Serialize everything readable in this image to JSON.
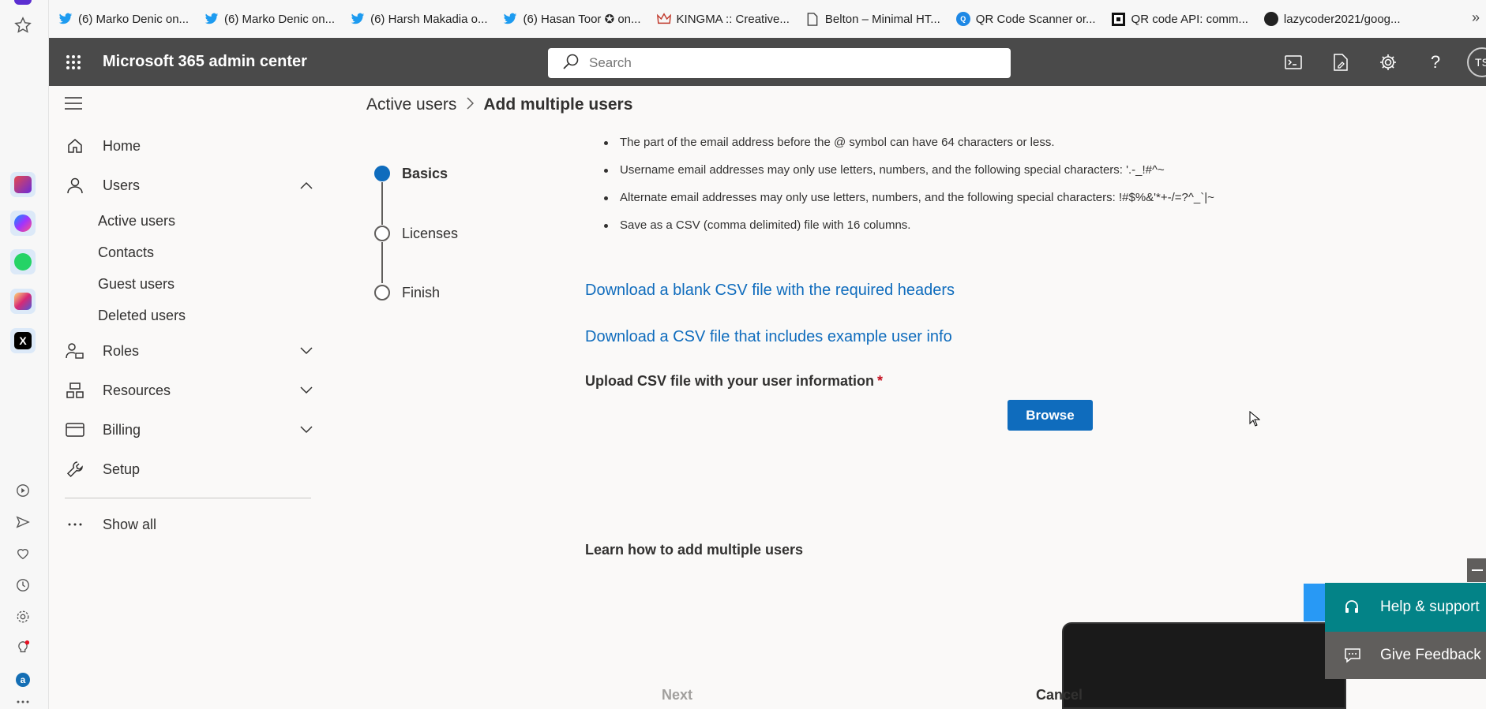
{
  "browser": {
    "bookmarks": [
      {
        "label": "(6) Marko Denic on...",
        "icon": "twitter-icon"
      },
      {
        "label": "(6) Marko Denic on...",
        "icon": "twitter-icon"
      },
      {
        "label": "(6) Harsh Makadia o...",
        "icon": "twitter-icon"
      },
      {
        "label": "(6) Hasan Toor ✪ on...",
        "icon": "twitter-icon"
      },
      {
        "label": "KINGMA :: Creative...",
        "icon": "crown-icon"
      },
      {
        "label": "Belton – Minimal HT...",
        "icon": "document-icon"
      },
      {
        "label": "QR Code Scanner or...",
        "icon": "qr-icon"
      },
      {
        "label": "QR code API: comm...",
        "icon": "qr-api-icon"
      },
      {
        "label": "lazycoder2021/goog...",
        "icon": "github-icon"
      }
    ]
  },
  "header": {
    "app_title": "Microsoft 365 admin center",
    "search_placeholder": "Search",
    "avatar_initials": "TS"
  },
  "nav": {
    "home": "Home",
    "users": "Users",
    "users_sub": [
      "Active users",
      "Contacts",
      "Guest users",
      "Deleted users"
    ],
    "roles": "Roles",
    "resources": "Resources",
    "billing": "Billing",
    "setup": "Setup",
    "show_all": "Show all"
  },
  "breadcrumb": {
    "root": "Active users",
    "current": "Add multiple users"
  },
  "steps": [
    "Basics",
    "Licenses",
    "Finish"
  ],
  "rules": [
    "The part of the email address before the @ symbol can have 64 characters or less.",
    "Username email addresses may only use letters, numbers, and the following special characters: '.-_!#^~",
    "Alternate email addresses may only use letters, numbers, and the following special characters: !#$%&'*+-/=?^_`|~",
    "Save as a CSV (comma delimited) file with 16 columns."
  ],
  "links": {
    "blank_csv": "Download a blank CSV file with the required headers",
    "example_csv": "Download a CSV file that includes example user info"
  },
  "upload": {
    "label": "Upload CSV file with your user information",
    "required_mark": "*",
    "browse": "Browse"
  },
  "learn": "Learn how to add multiple users",
  "footer": {
    "next": "Next",
    "cancel": "Cancel"
  },
  "help_panel": {
    "help": "Help & support",
    "feedback": "Give Feedback"
  },
  "colors": {
    "header_bg": "#4a4a4a",
    "accent": "#0f6cbd",
    "help_bg": "#038387",
    "feedback_bg": "#605e5c"
  }
}
